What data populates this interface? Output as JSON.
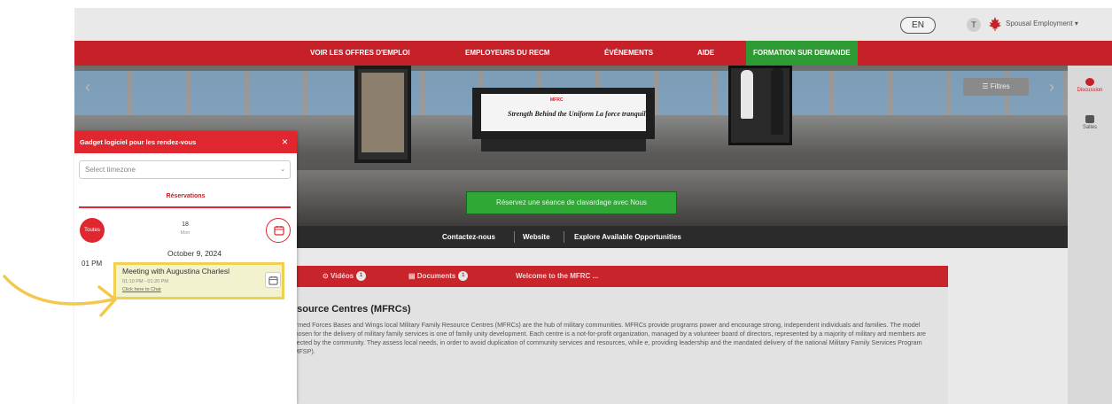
{
  "topbar": {
    "lang": "EN",
    "user_initial": "T",
    "user_label": "Spousal Employment ▾"
  },
  "nav": {
    "items": [
      "VOIR LES OFFRES D'EMPLOI",
      "EMPLOYEURS DU RECM",
      "ÉVÉNEMENTS",
      "AIDE"
    ],
    "active": "FORMATION SUR DEMANDE"
  },
  "banner": {
    "desk_logo": "MFRC",
    "desk_text": "Strength Behind the Uniform  La force tranquille",
    "filters_label": "☰ Filtres",
    "chat_button": "Réservez une séance de clavardage avec Nous",
    "arrow_left": "‹",
    "arrow_right": "›"
  },
  "links_bar": {
    "items": [
      "Contactez-nous",
      "Website",
      "Explore Available Opportunities"
    ]
  },
  "right_rail": {
    "items": [
      {
        "label": "Discussion",
        "color": "#c62128"
      },
      {
        "label": "Salles",
        "color": "#555555"
      }
    ]
  },
  "tabs": [
    {
      "label": "Vidéos",
      "icon": "play-icon",
      "count": "1"
    },
    {
      "label": "Documents",
      "icon": "document-icon",
      "count": "1"
    },
    {
      "label": "Welcome to the MFRC ..."
    }
  ],
  "content": {
    "title": "esource Centres (MFRCs)",
    "body": "Armed Forces Bases and Wings local Military Family Resource Centres (MFRCs) are the hub of military communities. MFRCs provide programs power and encourage strong, independent individuals and families. The model chosen for the delivery of military family services is one of family unity development. Each centre is a not-for-profit organization, managed by a volunteer board of directors, represented by a majority of military ard members are elected by the community. They assess local needs, in order to avoid duplication of community services and resources, while e, providing leadership and the mandated delivery of the national Military Family Services Program (MFSP)."
  },
  "panel": {
    "title": "Gadget logiciel pour les rendez-vous",
    "close": "×",
    "timezone_placeholder": "Select timezone",
    "tab": "Réservations",
    "all_button": "Toutes",
    "date_num": "18",
    "date_day": "Mon",
    "day_heading": "October 9, 2024",
    "time_label": "01 PM",
    "meeting": {
      "title": "Meeting with Augustina Charlesl",
      "time": "01:10 PM - 01:20 PM",
      "link": "Click here to Chat"
    }
  },
  "colors": {
    "brand_red": "#c62128",
    "active_green": "#2e9a34",
    "highlight_yellow": "#f0d050"
  }
}
